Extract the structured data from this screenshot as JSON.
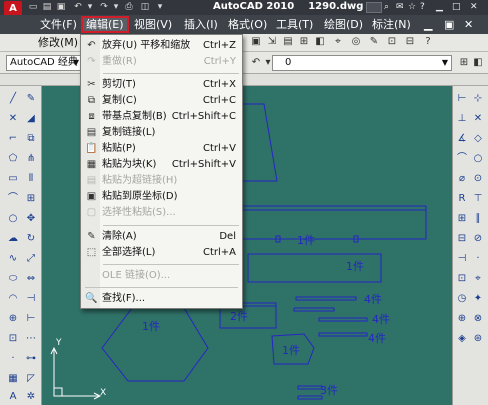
{
  "title_bar": {
    "app_name": "AutoCAD 2010",
    "file_name": "1290.dwg",
    "undo_icon": "undo-icon",
    "redo_icon": "redo-icon"
  },
  "menu_bar": {
    "items": [
      "文件(F)",
      "编辑(E)",
      "视图(V)",
      "插入(I)",
      "格式(O)",
      "工具(T)",
      "绘图(D)",
      "标注(N)"
    ],
    "second_row": "修改(M)"
  },
  "toolbar": {
    "workspace": "AutoCAD 经典",
    "layer_value": "0"
  },
  "edit_menu": {
    "items": [
      {
        "label": "放弃(U) 平移和缩放",
        "shortcut": "Ctrl+Z",
        "enabled": true,
        "icon": "undo-icon"
      },
      {
        "label": "重做(R)",
        "shortcut": "Ctrl+Y",
        "enabled": false,
        "icon": "redo-icon"
      },
      {
        "label": "剪切(T)",
        "shortcut": "Ctrl+X",
        "enabled": true,
        "icon": "scissors-icon"
      },
      {
        "label": "复制(C)",
        "shortcut": "Ctrl+C",
        "enabled": true,
        "icon": "copy-icon"
      },
      {
        "label": "带基点复制(B)",
        "shortcut": "Ctrl+Shift+C",
        "enabled": true,
        "icon": "copy-base-icon"
      },
      {
        "label": "复制链接(L)",
        "shortcut": "",
        "enabled": true,
        "icon": "copy-link-icon"
      },
      {
        "label": "粘贴(P)",
        "shortcut": "Ctrl+V",
        "enabled": true,
        "icon": "paste-icon"
      },
      {
        "label": "粘贴为块(K)",
        "shortcut": "Ctrl+Shift+V",
        "enabled": true,
        "icon": "paste-block-icon"
      },
      {
        "label": "粘贴为超链接(H)",
        "shortcut": "",
        "enabled": false,
        "icon": "paste-hyperlink-icon"
      },
      {
        "label": "粘贴到原坐标(D)",
        "shortcut": "",
        "enabled": true,
        "icon": "paste-original-icon"
      },
      {
        "label": "选择性粘贴(S)...",
        "shortcut": "",
        "enabled": false,
        "icon": "paste-special-icon"
      },
      {
        "label": "清除(A)",
        "shortcut": "Del",
        "enabled": true,
        "icon": "eraser-icon"
      },
      {
        "label": "全部选择(L)",
        "shortcut": "Ctrl+A",
        "enabled": true,
        "icon": "select-all-icon"
      },
      {
        "label": "OLE 链接(O)...",
        "shortcut": "",
        "enabled": false,
        "icon": ""
      },
      {
        "label": "查找(F)...",
        "shortcut": "",
        "enabled": true,
        "icon": "find-icon"
      }
    ]
  },
  "drawing": {
    "labels": [
      "1件",
      "1件",
      "2件",
      "4件",
      "4件",
      "4件",
      "1件",
      "1件",
      "3件"
    ],
    "ucs_x": "X",
    "ucs_y": "Y"
  },
  "colors": {
    "canvas": "#2f7268",
    "geometry": "#2626c4",
    "highlight": "#d21d2a"
  }
}
